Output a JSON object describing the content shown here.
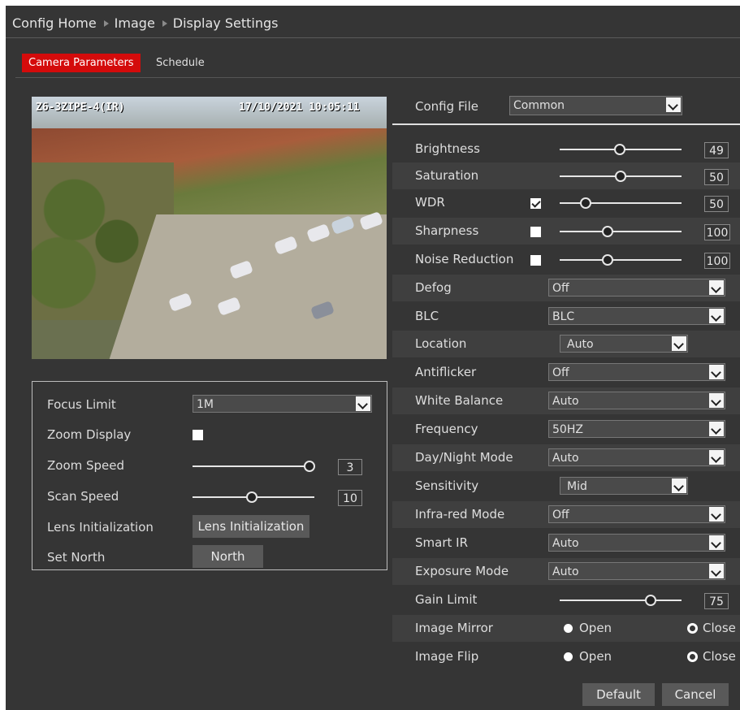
{
  "breadcrumb": [
    "Config Home",
    "Image",
    "Display Settings"
  ],
  "tabs": [
    "Camera Parameters",
    "Schedule"
  ],
  "video": {
    "camera_name": "Z6-3ZIPE-4(IR)",
    "timestamp": "17/10/2021 10:05:11"
  },
  "lens": {
    "focus_limit_label": "Focus Limit",
    "focus_limit_value": "1M",
    "zoom_display_label": "Zoom Display",
    "zoom_speed_label": "Zoom Speed",
    "zoom_speed_value": "3",
    "scan_speed_label": "Scan Speed",
    "scan_speed_value": "10",
    "lens_init_label": "Lens Initialization",
    "lens_init_button": "Lens Initialization",
    "set_north_label": "Set North",
    "north_button": "North"
  },
  "config": {
    "label": "Config File",
    "value": "Common"
  },
  "image": {
    "brightness": {
      "label": "Brightness",
      "value": "49"
    },
    "saturation": {
      "label": "Saturation",
      "value": "50"
    },
    "wdr": {
      "label": "WDR",
      "value": "50"
    },
    "sharpness": {
      "label": "Sharpness",
      "value": "100"
    },
    "noise": {
      "label": "Noise Reduction",
      "value": "100"
    },
    "defog": {
      "label": "Defog",
      "value": "Off"
    },
    "blc": {
      "label": "BLC",
      "value": "BLC"
    },
    "location": {
      "label": "Location",
      "value": "Auto"
    },
    "antiflicker": {
      "label": "Antiflicker",
      "value": "Off"
    },
    "white_balance": {
      "label": "White Balance",
      "value": "Auto"
    },
    "frequency": {
      "label": "Frequency",
      "value": "50HZ"
    },
    "day_night": {
      "label": "Day/Night Mode",
      "value": "Auto"
    },
    "sensitivity": {
      "label": "Sensitivity",
      "value": "Mid"
    },
    "infrared": {
      "label": "Infra-red Mode",
      "value": "Off"
    },
    "smart_ir": {
      "label": "Smart IR",
      "value": "Auto"
    },
    "exposure": {
      "label": "Exposure Mode",
      "value": "Auto"
    },
    "gain": {
      "label": "Gain Limit",
      "value": "75"
    },
    "mirror": {
      "label": "Image Mirror",
      "open": "Open",
      "close": "Close"
    },
    "flip": {
      "label": "Image Flip",
      "open": "Open",
      "close": "Close"
    }
  },
  "buttons": {
    "default": "Default",
    "cancel": "Cancel"
  },
  "colors": {
    "active_tab": "#d40b0b",
    "panel_bg": "#353535"
  }
}
